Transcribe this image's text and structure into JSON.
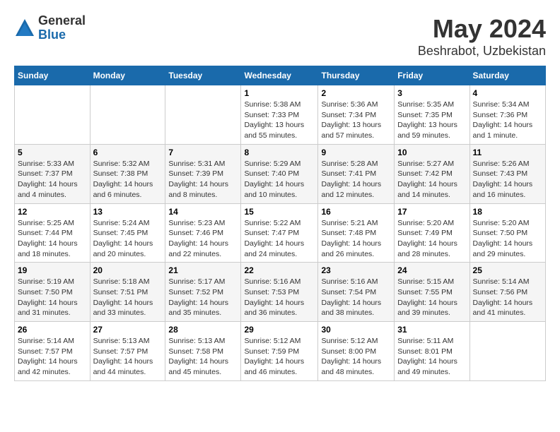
{
  "header": {
    "logo_general": "General",
    "logo_blue": "Blue",
    "month": "May 2024",
    "location": "Beshrabot, Uzbekistan"
  },
  "days_of_week": [
    "Sunday",
    "Monday",
    "Tuesday",
    "Wednesday",
    "Thursday",
    "Friday",
    "Saturday"
  ],
  "weeks": [
    [
      {
        "day": "",
        "info": ""
      },
      {
        "day": "",
        "info": ""
      },
      {
        "day": "",
        "info": ""
      },
      {
        "day": "1",
        "info": "Sunrise: 5:38 AM\nSunset: 7:33 PM\nDaylight: 13 hours\nand 55 minutes."
      },
      {
        "day": "2",
        "info": "Sunrise: 5:36 AM\nSunset: 7:34 PM\nDaylight: 13 hours\nand 57 minutes."
      },
      {
        "day": "3",
        "info": "Sunrise: 5:35 AM\nSunset: 7:35 PM\nDaylight: 13 hours\nand 59 minutes."
      },
      {
        "day": "4",
        "info": "Sunrise: 5:34 AM\nSunset: 7:36 PM\nDaylight: 14 hours\nand 1 minute."
      }
    ],
    [
      {
        "day": "5",
        "info": "Sunrise: 5:33 AM\nSunset: 7:37 PM\nDaylight: 14 hours\nand 4 minutes."
      },
      {
        "day": "6",
        "info": "Sunrise: 5:32 AM\nSunset: 7:38 PM\nDaylight: 14 hours\nand 6 minutes."
      },
      {
        "day": "7",
        "info": "Sunrise: 5:31 AM\nSunset: 7:39 PM\nDaylight: 14 hours\nand 8 minutes."
      },
      {
        "day": "8",
        "info": "Sunrise: 5:29 AM\nSunset: 7:40 PM\nDaylight: 14 hours\nand 10 minutes."
      },
      {
        "day": "9",
        "info": "Sunrise: 5:28 AM\nSunset: 7:41 PM\nDaylight: 14 hours\nand 12 minutes."
      },
      {
        "day": "10",
        "info": "Sunrise: 5:27 AM\nSunset: 7:42 PM\nDaylight: 14 hours\nand 14 minutes."
      },
      {
        "day": "11",
        "info": "Sunrise: 5:26 AM\nSunset: 7:43 PM\nDaylight: 14 hours\nand 16 minutes."
      }
    ],
    [
      {
        "day": "12",
        "info": "Sunrise: 5:25 AM\nSunset: 7:44 PM\nDaylight: 14 hours\nand 18 minutes."
      },
      {
        "day": "13",
        "info": "Sunrise: 5:24 AM\nSunset: 7:45 PM\nDaylight: 14 hours\nand 20 minutes."
      },
      {
        "day": "14",
        "info": "Sunrise: 5:23 AM\nSunset: 7:46 PM\nDaylight: 14 hours\nand 22 minutes."
      },
      {
        "day": "15",
        "info": "Sunrise: 5:22 AM\nSunset: 7:47 PM\nDaylight: 14 hours\nand 24 minutes."
      },
      {
        "day": "16",
        "info": "Sunrise: 5:21 AM\nSunset: 7:48 PM\nDaylight: 14 hours\nand 26 minutes."
      },
      {
        "day": "17",
        "info": "Sunrise: 5:20 AM\nSunset: 7:49 PM\nDaylight: 14 hours\nand 28 minutes."
      },
      {
        "day": "18",
        "info": "Sunrise: 5:20 AM\nSunset: 7:50 PM\nDaylight: 14 hours\nand 29 minutes."
      }
    ],
    [
      {
        "day": "19",
        "info": "Sunrise: 5:19 AM\nSunset: 7:50 PM\nDaylight: 14 hours\nand 31 minutes."
      },
      {
        "day": "20",
        "info": "Sunrise: 5:18 AM\nSunset: 7:51 PM\nDaylight: 14 hours\nand 33 minutes."
      },
      {
        "day": "21",
        "info": "Sunrise: 5:17 AM\nSunset: 7:52 PM\nDaylight: 14 hours\nand 35 minutes."
      },
      {
        "day": "22",
        "info": "Sunrise: 5:16 AM\nSunset: 7:53 PM\nDaylight: 14 hours\nand 36 minutes."
      },
      {
        "day": "23",
        "info": "Sunrise: 5:16 AM\nSunset: 7:54 PM\nDaylight: 14 hours\nand 38 minutes."
      },
      {
        "day": "24",
        "info": "Sunrise: 5:15 AM\nSunset: 7:55 PM\nDaylight: 14 hours\nand 39 minutes."
      },
      {
        "day": "25",
        "info": "Sunrise: 5:14 AM\nSunset: 7:56 PM\nDaylight: 14 hours\nand 41 minutes."
      }
    ],
    [
      {
        "day": "26",
        "info": "Sunrise: 5:14 AM\nSunset: 7:57 PM\nDaylight: 14 hours\nand 42 minutes."
      },
      {
        "day": "27",
        "info": "Sunrise: 5:13 AM\nSunset: 7:57 PM\nDaylight: 14 hours\nand 44 minutes."
      },
      {
        "day": "28",
        "info": "Sunrise: 5:13 AM\nSunset: 7:58 PM\nDaylight: 14 hours\nand 45 minutes."
      },
      {
        "day": "29",
        "info": "Sunrise: 5:12 AM\nSunset: 7:59 PM\nDaylight: 14 hours\nand 46 minutes."
      },
      {
        "day": "30",
        "info": "Sunrise: 5:12 AM\nSunset: 8:00 PM\nDaylight: 14 hours\nand 48 minutes."
      },
      {
        "day": "31",
        "info": "Sunrise: 5:11 AM\nSunset: 8:01 PM\nDaylight: 14 hours\nand 49 minutes."
      },
      {
        "day": "",
        "info": ""
      }
    ]
  ]
}
